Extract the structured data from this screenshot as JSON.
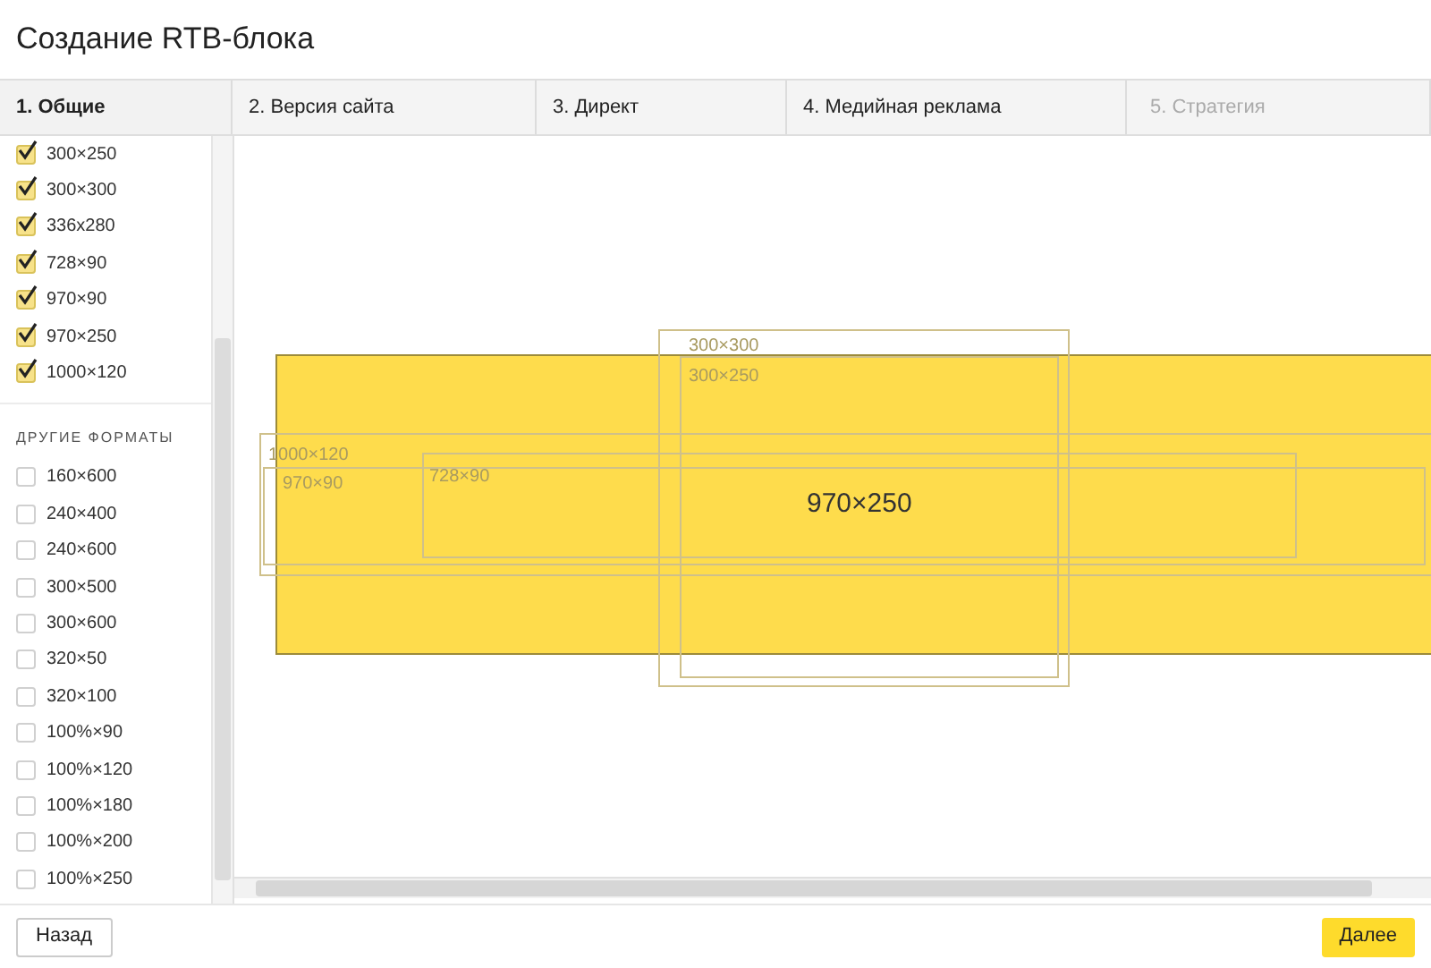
{
  "window": {
    "title": "Создание RTB-блока"
  },
  "steps": [
    {
      "label": "1. Общие",
      "selected": true,
      "disabled": false
    },
    {
      "label": "2. Версия сайта",
      "selected": false,
      "disabled": false
    },
    {
      "label": "3. Директ",
      "selected": false,
      "disabled": false
    },
    {
      "label": "4. Медийная реклама",
      "selected": false,
      "disabled": false
    },
    {
      "label": "5. Стратегия",
      "selected": false,
      "disabled": true
    }
  ],
  "format_groups": [
    {
      "items": [
        {
          "label": "300×250",
          "checked": true
        },
        {
          "label": "300×300",
          "checked": true
        },
        {
          "label": "336x280",
          "checked": true
        },
        {
          "label": "728×90",
          "checked": true
        },
        {
          "label": "970×90",
          "checked": true
        },
        {
          "label": "970×250",
          "checked": true
        },
        {
          "label": "1000×120",
          "checked": true
        }
      ]
    },
    {
      "heading": "ДРУГИЕ ФОРМАТЫ",
      "items": [
        {
          "label": "160×600",
          "checked": false
        },
        {
          "label": "240×400",
          "checked": false
        },
        {
          "label": "240×600",
          "checked": false
        },
        {
          "label": "300×500",
          "checked": false
        },
        {
          "label": "300×600",
          "checked": false
        },
        {
          "label": "320×50",
          "checked": false
        },
        {
          "label": "320×100",
          "checked": false
        },
        {
          "label": "100%×90",
          "checked": false
        },
        {
          "label": "100%×120",
          "checked": false
        },
        {
          "label": "100%×180",
          "checked": false
        },
        {
          "label": "100%×200",
          "checked": false
        },
        {
          "label": "100%×250",
          "checked": false
        }
      ]
    }
  ],
  "preview": {
    "selected_format": "970×250",
    "outlines": [
      {
        "label": "300×300"
      },
      {
        "label": "300×250"
      },
      {
        "label": "1000×120"
      },
      {
        "label": "970×90"
      },
      {
        "label": "728×90"
      }
    ]
  },
  "buttons": {
    "back": "Назад",
    "next": "Далее"
  }
}
